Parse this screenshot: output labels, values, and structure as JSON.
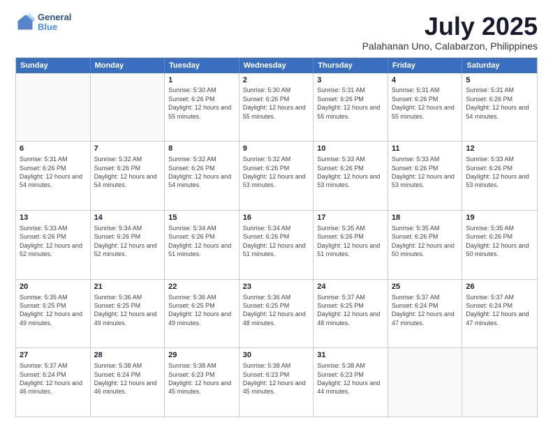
{
  "logo": {
    "line1": "General",
    "line2": "Blue"
  },
  "title": "July 2025",
  "subtitle": "Palahanan Uno, Calabarzon, Philippines",
  "header_days": [
    "Sunday",
    "Monday",
    "Tuesday",
    "Wednesday",
    "Thursday",
    "Friday",
    "Saturday"
  ],
  "weeks": [
    [
      {
        "day": "",
        "sunrise": "",
        "sunset": "",
        "daylight": "",
        "empty": true
      },
      {
        "day": "",
        "sunrise": "",
        "sunset": "",
        "daylight": "",
        "empty": true
      },
      {
        "day": "1",
        "sunrise": "Sunrise: 5:30 AM",
        "sunset": "Sunset: 6:26 PM",
        "daylight": "Daylight: 12 hours and 55 minutes."
      },
      {
        "day": "2",
        "sunrise": "Sunrise: 5:30 AM",
        "sunset": "Sunset: 6:26 PM",
        "daylight": "Daylight: 12 hours and 55 minutes."
      },
      {
        "day": "3",
        "sunrise": "Sunrise: 5:31 AM",
        "sunset": "Sunset: 6:26 PM",
        "daylight": "Daylight: 12 hours and 55 minutes."
      },
      {
        "day": "4",
        "sunrise": "Sunrise: 5:31 AM",
        "sunset": "Sunset: 6:26 PM",
        "daylight": "Daylight: 12 hours and 55 minutes."
      },
      {
        "day": "5",
        "sunrise": "Sunrise: 5:31 AM",
        "sunset": "Sunset: 6:26 PM",
        "daylight": "Daylight: 12 hours and 54 minutes."
      }
    ],
    [
      {
        "day": "6",
        "sunrise": "Sunrise: 5:31 AM",
        "sunset": "Sunset: 6:26 PM",
        "daylight": "Daylight: 12 hours and 54 minutes."
      },
      {
        "day": "7",
        "sunrise": "Sunrise: 5:32 AM",
        "sunset": "Sunset: 6:26 PM",
        "daylight": "Daylight: 12 hours and 54 minutes."
      },
      {
        "day": "8",
        "sunrise": "Sunrise: 5:32 AM",
        "sunset": "Sunset: 6:26 PM",
        "daylight": "Daylight: 12 hours and 54 minutes."
      },
      {
        "day": "9",
        "sunrise": "Sunrise: 5:32 AM",
        "sunset": "Sunset: 6:26 PM",
        "daylight": "Daylight: 12 hours and 53 minutes."
      },
      {
        "day": "10",
        "sunrise": "Sunrise: 5:33 AM",
        "sunset": "Sunset: 6:26 PM",
        "daylight": "Daylight: 12 hours and 53 minutes."
      },
      {
        "day": "11",
        "sunrise": "Sunrise: 5:33 AM",
        "sunset": "Sunset: 6:26 PM",
        "daylight": "Daylight: 12 hours and 53 minutes."
      },
      {
        "day": "12",
        "sunrise": "Sunrise: 5:33 AM",
        "sunset": "Sunset: 6:26 PM",
        "daylight": "Daylight: 12 hours and 53 minutes."
      }
    ],
    [
      {
        "day": "13",
        "sunrise": "Sunrise: 5:33 AM",
        "sunset": "Sunset: 6:26 PM",
        "daylight": "Daylight: 12 hours and 52 minutes."
      },
      {
        "day": "14",
        "sunrise": "Sunrise: 5:34 AM",
        "sunset": "Sunset: 6:26 PM",
        "daylight": "Daylight: 12 hours and 52 minutes."
      },
      {
        "day": "15",
        "sunrise": "Sunrise: 5:34 AM",
        "sunset": "Sunset: 6:26 PM",
        "daylight": "Daylight: 12 hours and 51 minutes."
      },
      {
        "day": "16",
        "sunrise": "Sunrise: 5:34 AM",
        "sunset": "Sunset: 6:26 PM",
        "daylight": "Daylight: 12 hours and 51 minutes."
      },
      {
        "day": "17",
        "sunrise": "Sunrise: 5:35 AM",
        "sunset": "Sunset: 6:26 PM",
        "daylight": "Daylight: 12 hours and 51 minutes."
      },
      {
        "day": "18",
        "sunrise": "Sunrise: 5:35 AM",
        "sunset": "Sunset: 6:26 PM",
        "daylight": "Daylight: 12 hours and 50 minutes."
      },
      {
        "day": "19",
        "sunrise": "Sunrise: 5:35 AM",
        "sunset": "Sunset: 6:26 PM",
        "daylight": "Daylight: 12 hours and 50 minutes."
      }
    ],
    [
      {
        "day": "20",
        "sunrise": "Sunrise: 5:35 AM",
        "sunset": "Sunset: 6:25 PM",
        "daylight": "Daylight: 12 hours and 49 minutes."
      },
      {
        "day": "21",
        "sunrise": "Sunrise: 5:36 AM",
        "sunset": "Sunset: 6:25 PM",
        "daylight": "Daylight: 12 hours and 49 minutes."
      },
      {
        "day": "22",
        "sunrise": "Sunrise: 5:36 AM",
        "sunset": "Sunset: 6:25 PM",
        "daylight": "Daylight: 12 hours and 49 minutes."
      },
      {
        "day": "23",
        "sunrise": "Sunrise: 5:36 AM",
        "sunset": "Sunset: 6:25 PM",
        "daylight": "Daylight: 12 hours and 48 minutes."
      },
      {
        "day": "24",
        "sunrise": "Sunrise: 5:37 AM",
        "sunset": "Sunset: 6:25 PM",
        "daylight": "Daylight: 12 hours and 48 minutes."
      },
      {
        "day": "25",
        "sunrise": "Sunrise: 5:37 AM",
        "sunset": "Sunset: 6:24 PM",
        "daylight": "Daylight: 12 hours and 47 minutes."
      },
      {
        "day": "26",
        "sunrise": "Sunrise: 5:37 AM",
        "sunset": "Sunset: 6:24 PM",
        "daylight": "Daylight: 12 hours and 47 minutes."
      }
    ],
    [
      {
        "day": "27",
        "sunrise": "Sunrise: 5:37 AM",
        "sunset": "Sunset: 6:24 PM",
        "daylight": "Daylight: 12 hours and 46 minutes."
      },
      {
        "day": "28",
        "sunrise": "Sunrise: 5:38 AM",
        "sunset": "Sunset: 6:24 PM",
        "daylight": "Daylight: 12 hours and 46 minutes."
      },
      {
        "day": "29",
        "sunrise": "Sunrise: 5:38 AM",
        "sunset": "Sunset: 6:23 PM",
        "daylight": "Daylight: 12 hours and 45 minutes."
      },
      {
        "day": "30",
        "sunrise": "Sunrise: 5:38 AM",
        "sunset": "Sunset: 6:23 PM",
        "daylight": "Daylight: 12 hours and 45 minutes."
      },
      {
        "day": "31",
        "sunrise": "Sunrise: 5:38 AM",
        "sunset": "Sunset: 6:23 PM",
        "daylight": "Daylight: 12 hours and 44 minutes."
      },
      {
        "day": "",
        "sunrise": "",
        "sunset": "",
        "daylight": "",
        "empty": true
      },
      {
        "day": "",
        "sunrise": "",
        "sunset": "",
        "daylight": "",
        "empty": true
      }
    ]
  ]
}
